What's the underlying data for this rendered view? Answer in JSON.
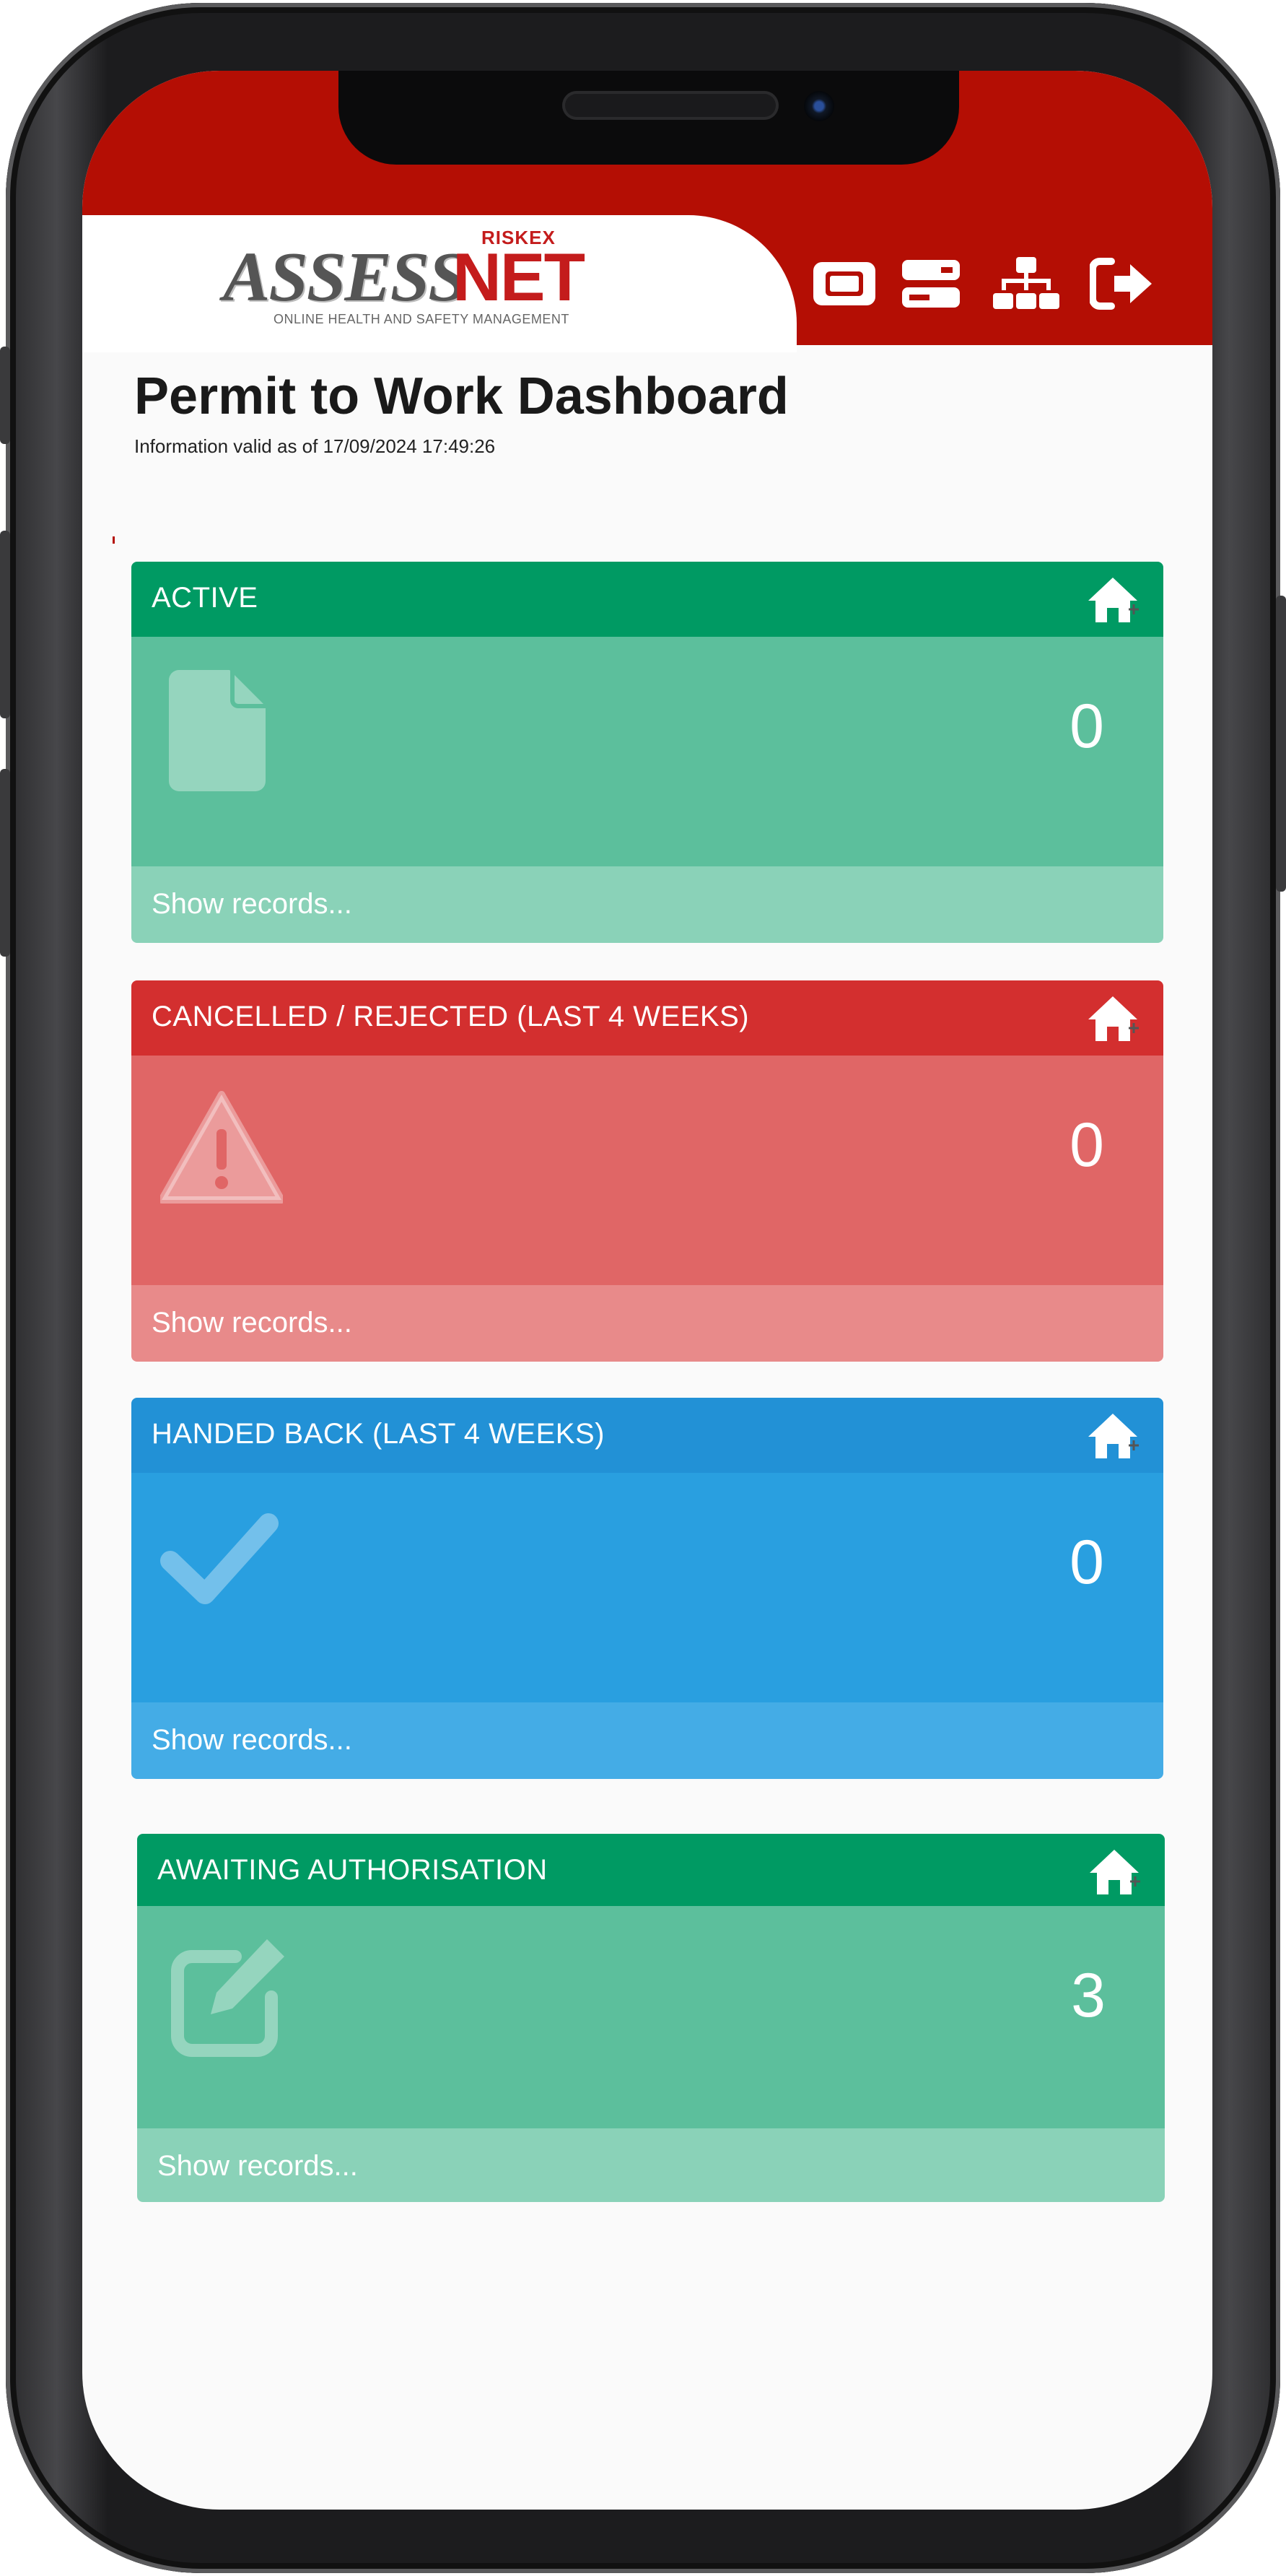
{
  "app": {
    "logo_assess": "ASSESS",
    "logo_net": "NET",
    "logo_riskex": "RISKEX",
    "logo_tagline": "ONLINE HEALTH AND SAFETY MANAGEMENT"
  },
  "header_icons": [
    {
      "icon": "ticket-icon"
    },
    {
      "icon": "server-icon"
    },
    {
      "icon": "sitemap-icon"
    },
    {
      "icon": "sign-out-icon"
    }
  ],
  "page": {
    "title": "Permit to Work Dashboard",
    "subtitle": "Information valid as of 17/09/2024 17:49:26"
  },
  "cards": [
    {
      "title": "ACTIVE",
      "count": "0",
      "link": "Show records...",
      "icon": "file-icon",
      "colors": {
        "head": "#009a63",
        "body": "#5cbf9c",
        "foot": "#8ad2b8"
      }
    },
    {
      "title": "CANCELLED / REJECTED (LAST 4 WEEKS)",
      "count": "0",
      "link": "Show records...",
      "icon": "warning-icon",
      "colors": {
        "head": "#d32f2f",
        "body": "#e06666",
        "foot": "#e88a8a"
      }
    },
    {
      "title": "HANDED BACK (LAST 4 WEEKS)",
      "count": "0",
      "link": "Show records...",
      "icon": "check-icon",
      "colors": {
        "head": "#2291d6",
        "body": "#299fe0",
        "foot": "#44ace6"
      }
    },
    {
      "title": "AWAITING AUTHORISATION",
      "count": "3",
      "link": "Show records...",
      "icon": "edit-icon",
      "colors": {
        "head": "#009a63",
        "body": "#5cbf9c",
        "foot": "#8ad2b8"
      }
    }
  ],
  "colors": {
    "brand_red": "#b40e04"
  }
}
